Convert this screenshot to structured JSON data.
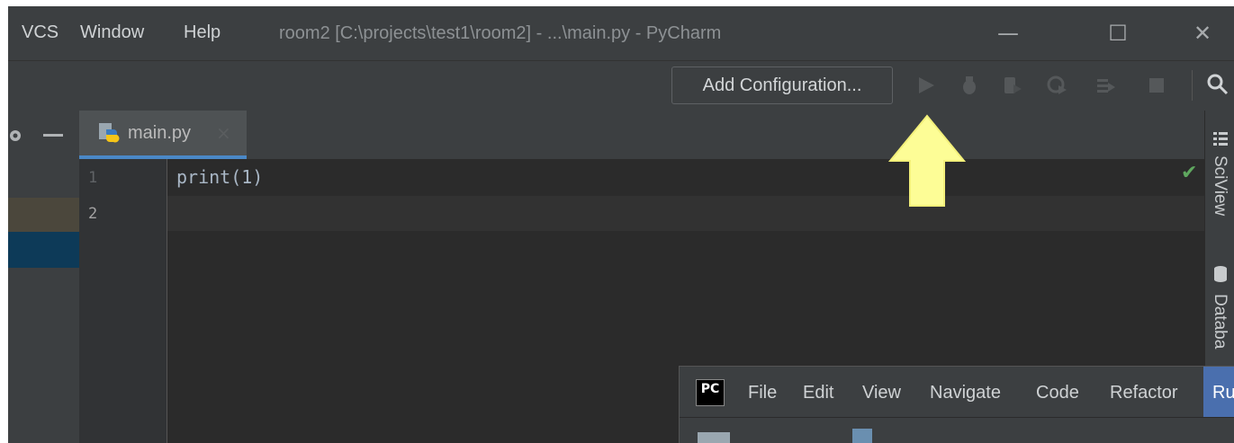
{
  "menu": {
    "vcs": "VCS",
    "window": "Window",
    "help": "Help"
  },
  "window_title": "room2 [C:\\projects\\test1\\room2] - ...\\main.py - PyCharm",
  "window_controls": {
    "minimize": "—",
    "maximize": "☐",
    "close": "✕"
  },
  "toolbar": {
    "add_configuration": "Add Configuration..."
  },
  "tabs": [
    {
      "label": "main.py",
      "close": "×"
    }
  ],
  "editor": {
    "line_numbers": [
      "1",
      "2"
    ],
    "lines": [
      "print(1)",
      ""
    ]
  },
  "right_panel": {
    "sciview": "SciView",
    "database": "Databa"
  },
  "overlay_window": {
    "menu": [
      "File",
      "Edit",
      "View",
      "Navigate",
      "Code",
      "Refactor",
      "Ru"
    ],
    "logo": "PC"
  },
  "colors": {
    "accent": "#4a88c7",
    "arrow": "#fdfd96"
  }
}
